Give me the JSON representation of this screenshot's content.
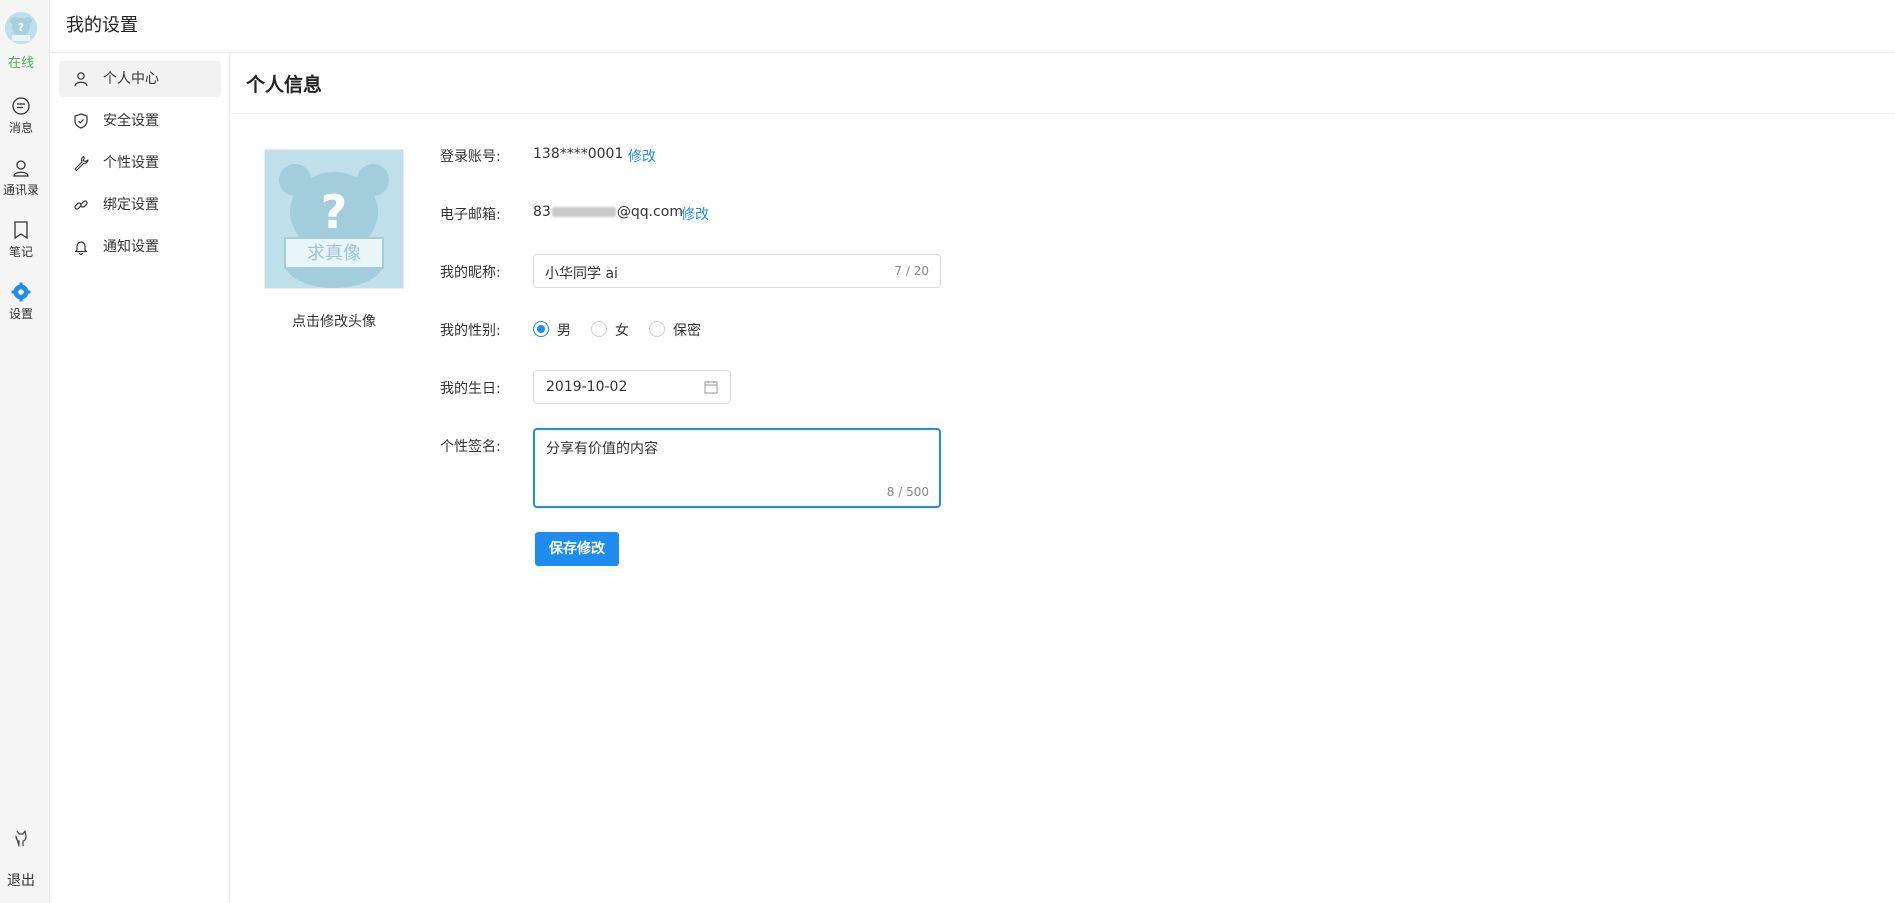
{
  "rail": {
    "status": "在线",
    "items": [
      {
        "label": "消息",
        "icon": "message-icon"
      },
      {
        "label": "通讯录",
        "icon": "contacts-icon"
      },
      {
        "label": "笔记",
        "icon": "notes-icon"
      },
      {
        "label": "设置",
        "icon": "settings-icon"
      }
    ],
    "logout": "退出",
    "avatar_stamp": "求真像"
  },
  "header": {
    "title": "我的设置"
  },
  "menu": {
    "items": [
      {
        "label": "个人中心",
        "icon": "user-icon",
        "active": true
      },
      {
        "label": "安全设置",
        "icon": "shield-icon",
        "active": false
      },
      {
        "label": "个性设置",
        "icon": "wrench-icon",
        "active": false
      },
      {
        "label": "绑定设置",
        "icon": "link-icon",
        "active": false
      },
      {
        "label": "通知设置",
        "icon": "bell-icon",
        "active": false
      }
    ]
  },
  "content": {
    "title": "个人信息",
    "avatar": {
      "caption": "点击修改头像",
      "stamp": "求真像"
    },
    "account": {
      "label": "登录账号:",
      "value": "138****0001",
      "action": "修改"
    },
    "email": {
      "label": "电子邮箱:",
      "value_prefix": "83",
      "value_suffix": "@qq.com",
      "action": "修改"
    },
    "nickname": {
      "label": "我的昵称:",
      "value": "小华同学 ai",
      "count": "7 / 20"
    },
    "gender": {
      "label": "我的性别:",
      "options": [
        "男",
        "女",
        "保密"
      ],
      "selected": "男"
    },
    "birthday": {
      "label": "我的生日:",
      "value": "2019-10-02"
    },
    "signature": {
      "label": "个性签名:",
      "value": "分享有价值的内容",
      "count": "8 / 500"
    },
    "save_label": "保存修改"
  },
  "colors": {
    "accent": "#1d8cf0",
    "online": "#4cb050"
  }
}
